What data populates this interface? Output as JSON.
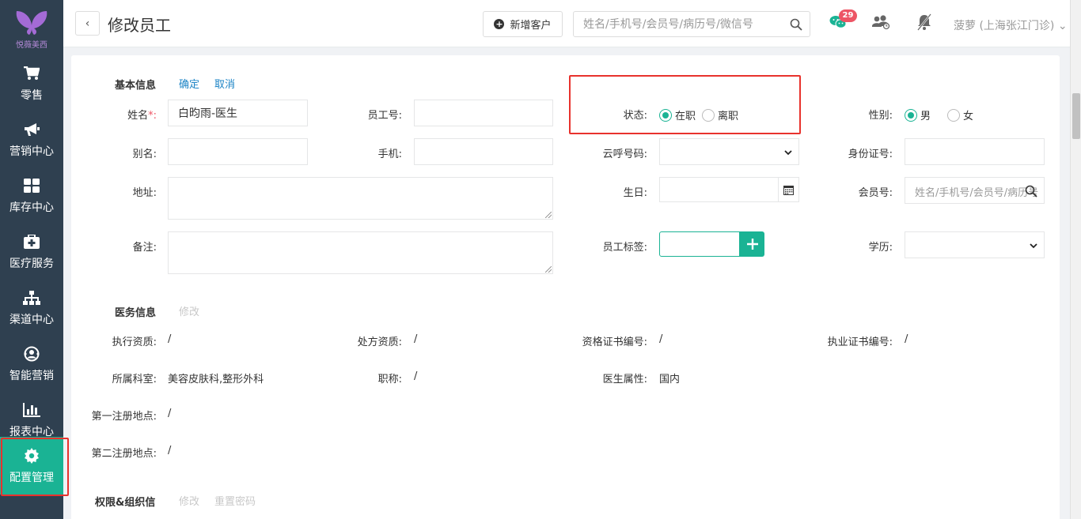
{
  "sidebar": {
    "logo_text": "悦薇美西",
    "items": [
      {
        "label": "零售",
        "icon": "cart-icon"
      },
      {
        "label": "营销中心",
        "icon": "megaphone-icon"
      },
      {
        "label": "库存中心",
        "icon": "grid-icon"
      },
      {
        "label": "医疗服务",
        "icon": "medkit-icon"
      },
      {
        "label": "渠道中心",
        "icon": "sitemap-icon"
      },
      {
        "label": "智能营销",
        "icon": "user-circle-icon"
      },
      {
        "label": "报表中心",
        "icon": "bar-chart-icon"
      },
      {
        "label": "配置管理",
        "icon": "gear-icon"
      }
    ],
    "active_index": 7
  },
  "header": {
    "back_symbol": "‹",
    "title": "修改员工",
    "new_customer_label": "新增客户",
    "search_placeholder": "姓名/手机号/会员号/病历号/微信号",
    "wechat_badge": "29",
    "user_name": "菠萝 (上海张江门诊)",
    "user_chevron": "⌄"
  },
  "basic_info": {
    "title": "基本信息",
    "confirm": "确定",
    "cancel": "取消",
    "name_label": "姓名",
    "required_mark": "*:",
    "name_value": "白昀雨-医生",
    "employee_no_label": "员工号:",
    "status_label": "状态:",
    "status_options": [
      "在职",
      "离职"
    ],
    "status_selected": 0,
    "gender_label": "性别:",
    "gender_options": [
      "男",
      "女"
    ],
    "gender_selected": 0,
    "alias_label": "别名:",
    "phone_label": "手机:",
    "cloud_phone_label": "云呼号码:",
    "id_card_label": "身份证号:",
    "address_label": "地址:",
    "birthday_label": "生日:",
    "member_no_label": "会员号:",
    "member_placeholder": "姓名/手机号/会员号/病历号",
    "remark_label": "备注:",
    "tag_label": "员工标签:",
    "education_label": "学历:"
  },
  "medical_info": {
    "title": "医务信息",
    "edit": "修改",
    "practice_qual_label": "执行资质:",
    "practice_qual_value": "/",
    "prescription_qual_label": "处方资质:",
    "prescription_qual_value": "/",
    "cert_no_label": "资格证书编号:",
    "cert_no_value": "/",
    "license_no_label": "执业证书编号:",
    "license_no_value": "/",
    "department_label": "所属科室:",
    "department_value": "美容皮肤科,整形外科",
    "job_title_label": "职称:",
    "job_title_value": "/",
    "doctor_attr_label": "医生属性:",
    "doctor_attr_value": "国内",
    "first_reg_label": "第一注册地点:",
    "first_reg_value": "/",
    "second_reg_label": "第二注册地点:",
    "second_reg_value": "/"
  },
  "permission_info": {
    "title": "权限&组织信",
    "edit": "修改",
    "reset_password": "重置密码"
  },
  "colors": {
    "sidebar_bg": "#2f4050",
    "accent": "#1ab394",
    "link": "#1c84c6",
    "highlight": "#e8322d",
    "badge": "#ed5565"
  }
}
